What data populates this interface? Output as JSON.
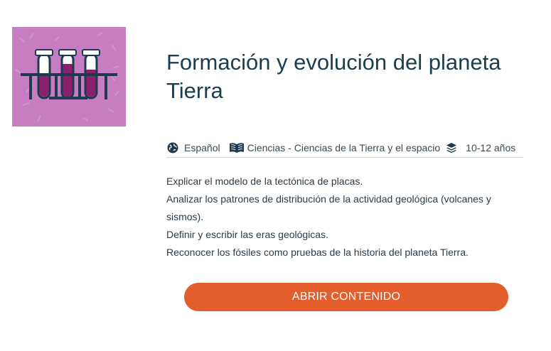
{
  "title": "Formación y evolución del planeta Tierra",
  "meta": {
    "language_icon": "globe-icon",
    "language": "Español",
    "subject_icon": "book-icon",
    "subject": "Ciencias - Ciencias de la Tierra y el espacio",
    "age_icon": "layers-icon",
    "age": "10-12 años"
  },
  "objectives": [
    "Explicar el modelo de la tectónica de placas.",
    "Analizar los patrones de distribución de la actividad geológica (volcanes y sismos).",
    "Definir y escribir las eras geológicas.",
    "Reconocer los fósiles como pruebas de la historia del planeta Tierra."
  ],
  "cta_label": "ABRIR CONTENIDO",
  "colors": {
    "thumbnail_bg": "#c77dc2",
    "tube_fill": "#8a1f6e",
    "rack": "#1f3a4d",
    "button": "#e35d2d",
    "title": "#1b3d50"
  }
}
